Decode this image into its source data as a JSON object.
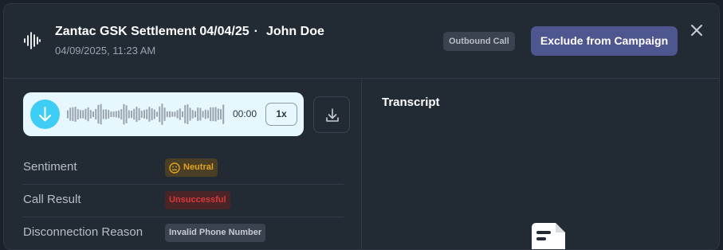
{
  "header": {
    "title": "Zantac GSK Settlement 04/04/25",
    "separator": "·",
    "contact_name": "John Doe",
    "subtitle": "04/09/2025, 11:23 AM",
    "call_type_badge": "Outbound Call",
    "exclude_button": "Exclude from Campaign"
  },
  "player": {
    "time": "00:00",
    "speed": "1x"
  },
  "details": [
    {
      "label": "Sentiment",
      "value": "Neutral",
      "icon": "neutral-face-icon"
    },
    {
      "label": "Call Result",
      "value": "Unsuccessful"
    },
    {
      "label": "Disconnection Reason",
      "value": "Invalid Phone Number"
    }
  ],
  "transcript": {
    "title": "Transcript"
  },
  "colors": {
    "accent": "#4e568f",
    "play": "#3ecdf5",
    "neutral": "#e0a222",
    "unsuccessful": "#d83a3a"
  }
}
